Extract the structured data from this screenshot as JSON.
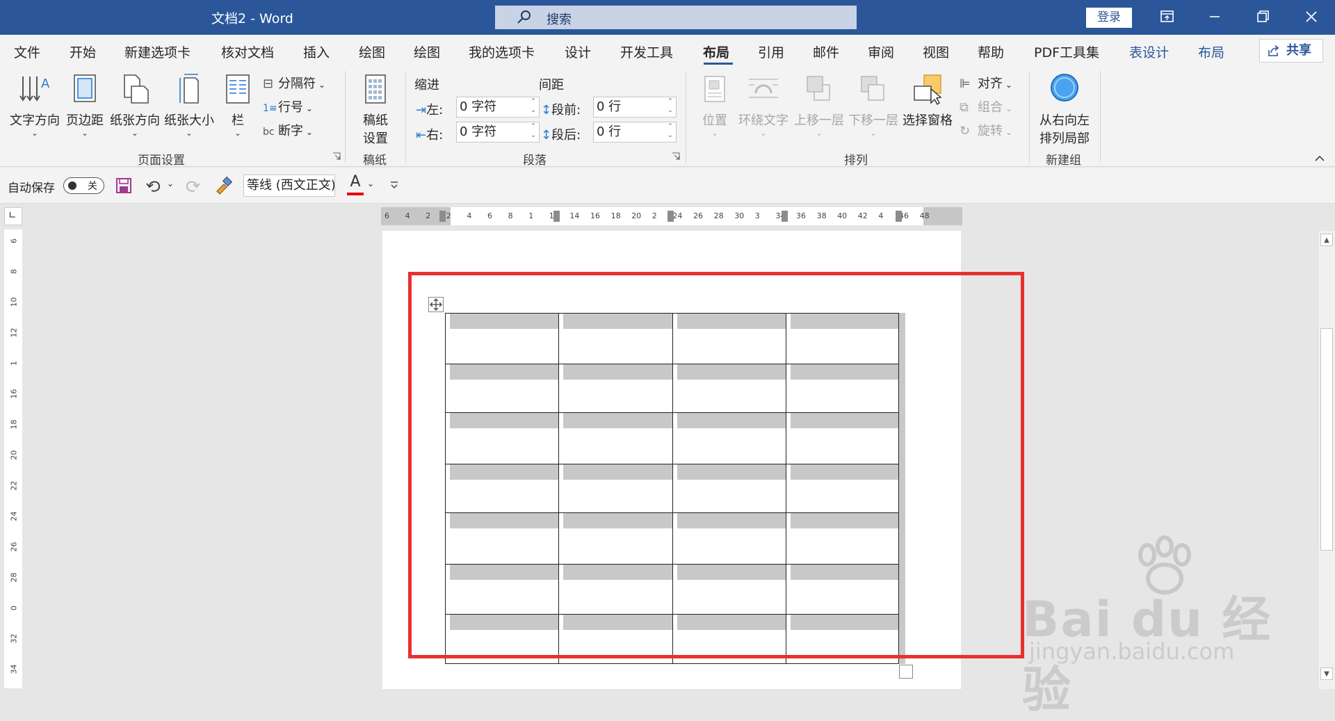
{
  "window": {
    "doc_title": "文档2  -  Word",
    "search_label": "搜索",
    "login_label": "登录"
  },
  "tabs": [
    "文件",
    "开始",
    "新建选项卡",
    "核对文档",
    "插入",
    "绘图",
    "绘图",
    "我的选项卡",
    "设计",
    "开发工具",
    "布局",
    "引用",
    "邮件",
    "审阅",
    "视图",
    "帮助",
    "PDF工具集",
    "表设计",
    "布局"
  ],
  "share_label": "共享",
  "ribbon": {
    "page_setup": {
      "text_direction": "文字方向",
      "margins": "页边距",
      "orientation": "纸张方向",
      "size": "纸张大小",
      "columns": "栏",
      "breaks": "分隔符",
      "line_numbers": "行号",
      "hyphenation": "断字",
      "group_label": "页面设置"
    },
    "manuscript": {
      "button_line1": "稿纸",
      "button_line2": "设置",
      "group_label": "稿纸"
    },
    "paragraph": {
      "indent_title": "缩进",
      "spacing_title": "间距",
      "left_label": "左:",
      "right_label": "右:",
      "before_label": "段前:",
      "after_label": "段后:",
      "left_value": "0 字符",
      "right_value": "0 字符",
      "before_value": "0 行",
      "after_value": "0 行",
      "group_label": "段落"
    },
    "arrange": {
      "position": "位置",
      "wrap_text": "环绕文字",
      "bring_forward": "上移一层",
      "send_backward": "下移一层",
      "selection_pane": "选择窗格",
      "align": "对齐",
      "group": "组合",
      "rotate": "旋转",
      "group_label": "排列"
    },
    "new_group": {
      "button_line1": "从右向左",
      "button_line2": "排列局部",
      "group_label": "新建组"
    }
  },
  "qat": {
    "autosave_label": "自动保存",
    "autosave_state": "关",
    "font_name": "等线 (西文正文)"
  },
  "ruler": {
    "h_ticks": [
      "6",
      "4",
      "2",
      "2",
      "4",
      "6",
      "8",
      "1",
      "12",
      "14",
      "16",
      "18",
      "20",
      "2",
      "24",
      "26",
      "28",
      "30",
      "3",
      "34",
      "36",
      "38",
      "40",
      "42",
      "4",
      "46",
      "48"
    ],
    "v_ticks": [
      "6",
      "8",
      "10",
      "12",
      "1",
      "16",
      "18",
      "20",
      "22",
      "24",
      "26",
      "28",
      "0",
      "32",
      "34"
    ]
  },
  "table": {
    "rows": 7,
    "cols": 4
  },
  "watermark": {
    "brand": "Bai du 经验",
    "url": "jingyan.baidu.com"
  },
  "colors": {
    "title_bar": "#2b579a",
    "highlight": "#e8312f",
    "cell_shade": "#c8c8c8"
  }
}
